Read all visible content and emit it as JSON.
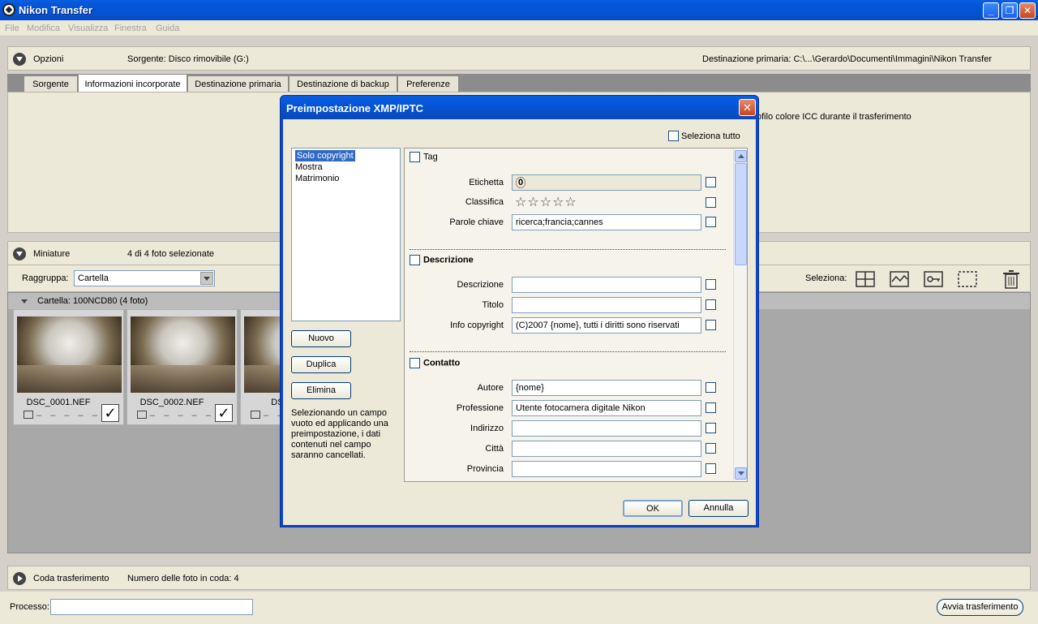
{
  "window": {
    "title": "Nikon Transfer"
  },
  "menu": [
    "File",
    "Modifica",
    "Visualizza",
    "Finestra",
    "Guida"
  ],
  "options_panel": {
    "label": "Opzioni",
    "source": "Sorgente: Disco rimovibile (G:)",
    "destination": "Destinazione primaria:  C:\\...\\Gerardo\\Documenti\\Immagini\\Nikon Transfer"
  },
  "tabs": [
    "Sorgente",
    "Informazioni incorporate",
    "Destinazione primaria",
    "Destinazione di backup",
    "Preferenze"
  ],
  "active_tab": 1,
  "tab_content_text": "ofilo colore ICC durante il trasferimento",
  "thumbs_panel": {
    "label": "Miniature",
    "count": "4 di 4 foto selezionate",
    "group_label": "Raggruppa:",
    "group_value": "Cartella",
    "select_label": "Seleziona:",
    "folder": "Cartella: 100NCD80 (4 foto)"
  },
  "thumbnails": [
    {
      "name": "DSC_0001.NEF",
      "checked": true
    },
    {
      "name": "DSC_0002.NEF",
      "checked": true
    },
    {
      "name": "DSC_0",
      "checked": true
    }
  ],
  "queue_panel": {
    "label": "Coda trasferimento",
    "count": "Numero delle foto in coda: 4"
  },
  "status": {
    "process_label": "Processo:",
    "start_button": "Avvia trasferimento"
  },
  "dialog": {
    "title": "Preimpostazione XMP/IPTC",
    "select_all": "Seleziona tutto",
    "presets": [
      "Solo copyright",
      "Mostra",
      "Matrimonio"
    ],
    "buttons": {
      "new": "Nuovo",
      "duplicate": "Duplica",
      "delete": "Elimina",
      "ok": "OK",
      "cancel": "Annulla"
    },
    "help_text": "Selezionando un campo vuoto ed applicando una preimpostazione, i dati contenuti nel campo saranno cancellati.",
    "sections": {
      "tag": {
        "title": "Tag",
        "label_field": {
          "label": "Etichetta",
          "value": "0"
        },
        "rating_field": {
          "label": "Classifica",
          "stars": "☆☆☆☆☆"
        },
        "keywords_field": {
          "label": "Parole chiave",
          "value": "ricerca;francia;cannes"
        }
      },
      "description": {
        "title": "Descrizione",
        "fields": [
          {
            "label": "Descrizione",
            "value": ""
          },
          {
            "label": "Titolo",
            "value": ""
          },
          {
            "label": "Info copyright",
            "value": "(C)2007 {nome}, tutti i diritti sono riservati"
          }
        ]
      },
      "contact": {
        "title": "Contatto",
        "fields": [
          {
            "label": "Autore",
            "value": "{nome}"
          },
          {
            "label": "Professione",
            "value": "Utente fotocamera digitale Nikon"
          },
          {
            "label": "Indirizzo",
            "value": ""
          },
          {
            "label": "Città",
            "value": ""
          },
          {
            "label": "Provincia",
            "value": ""
          }
        ]
      }
    }
  }
}
